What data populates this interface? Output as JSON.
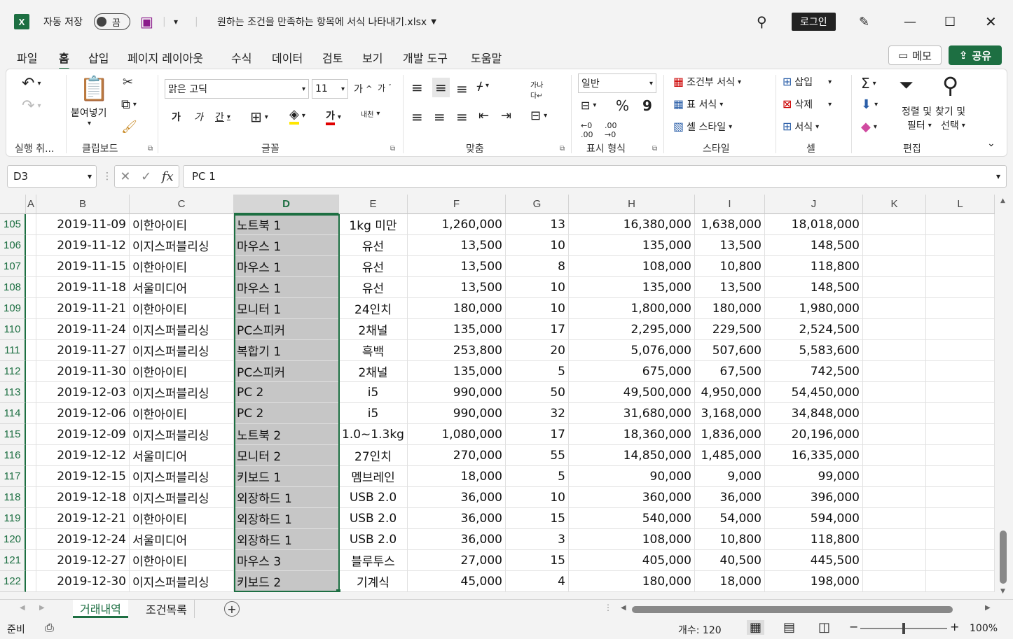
{
  "titlebar": {
    "app_icon": "X",
    "autosave_label": "자동 저장",
    "autosave_state": "끔",
    "filename": "원하는 조건을 만족하는 항목에 서식 나타내기.xlsx",
    "login": "로그인"
  },
  "ribbon_tabs": [
    "파일",
    "홈",
    "삽입",
    "페이지 레이아웃",
    "수식",
    "데이터",
    "검토",
    "보기",
    "개발 도구",
    "도움말"
  ],
  "active_tab": "홈",
  "memo_label": "메모",
  "share_label": "공유",
  "ribbon": {
    "undo_group": "실행 취...",
    "clipboard_group": "클립보드",
    "paste_label": "붙여넣기",
    "font_group": "글꼴",
    "font_name": "맑은 고딕",
    "font_size": "11",
    "grow_font": "가",
    "shrink_font": "가",
    "bold": "가",
    "italic": "가",
    "underline": "간",
    "font_color_letter": "가",
    "phonetic": "내천",
    "align_group": "맞춤",
    "number_group": "표시 형식",
    "number_format": "일반",
    "percent": "%",
    "comma": "9",
    "styles_group": "스타일",
    "conditional": "조건부 서식",
    "format_table": "표 서식",
    "cell_styles": "셀 스타일",
    "cells_group": "셀",
    "insert": "삽입",
    "delete": "삭제",
    "format": "서식",
    "edit_group": "편집",
    "sort_filter_1": "정렬 및",
    "sort_filter_2": "필터",
    "find_select_1": "찾기 및",
    "find_select_2": "선택"
  },
  "formula_bar": {
    "name_box": "D3",
    "fx": "fx",
    "content": "PC 1"
  },
  "columns": [
    "A",
    "B",
    "C",
    "D",
    "E",
    "F",
    "G",
    "H",
    "I",
    "J",
    "K",
    "L"
  ],
  "selected_column": "D",
  "rows": [
    {
      "n": "105",
      "B": "2019-11-09",
      "C": "이한아이티",
      "D": "노트북 1",
      "E": "1kg 미만",
      "F": "1,260,000",
      "G": "13",
      "H": "16,380,000",
      "I": "1,638,000",
      "J": "18,018,000"
    },
    {
      "n": "106",
      "B": "2019-11-12",
      "C": "이지스퍼블리싱",
      "D": "마우스 1",
      "E": "유선",
      "F": "13,500",
      "G": "10",
      "H": "135,000",
      "I": "13,500",
      "J": "148,500"
    },
    {
      "n": "107",
      "B": "2019-11-15",
      "C": "이한아이티",
      "D": "마우스 1",
      "E": "유선",
      "F": "13,500",
      "G": "8",
      "H": "108,000",
      "I": "10,800",
      "J": "118,800"
    },
    {
      "n": "108",
      "B": "2019-11-18",
      "C": "서울미디어",
      "D": "마우스 1",
      "E": "유선",
      "F": "13,500",
      "G": "10",
      "H": "135,000",
      "I": "13,500",
      "J": "148,500"
    },
    {
      "n": "109",
      "B": "2019-11-21",
      "C": "이한아이티",
      "D": "모니터 1",
      "E": "24인치",
      "F": "180,000",
      "G": "10",
      "H": "1,800,000",
      "I": "180,000",
      "J": "1,980,000"
    },
    {
      "n": "110",
      "B": "2019-11-24",
      "C": "이지스퍼블리싱",
      "D": "PC스피커",
      "E": "2채널",
      "F": "135,000",
      "G": "17",
      "H": "2,295,000",
      "I": "229,500",
      "J": "2,524,500"
    },
    {
      "n": "111",
      "B": "2019-11-27",
      "C": "이지스퍼블리싱",
      "D": "복합기 1",
      "E": "흑백",
      "F": "253,800",
      "G": "20",
      "H": "5,076,000",
      "I": "507,600",
      "J": "5,583,600"
    },
    {
      "n": "112",
      "B": "2019-11-30",
      "C": "이한아이티",
      "D": "PC스피커",
      "E": "2채널",
      "F": "135,000",
      "G": "5",
      "H": "675,000",
      "I": "67,500",
      "J": "742,500"
    },
    {
      "n": "113",
      "B": "2019-12-03",
      "C": "이지스퍼블리싱",
      "D": "PC 2",
      "E": "i5",
      "F": "990,000",
      "G": "50",
      "H": "49,500,000",
      "I": "4,950,000",
      "J": "54,450,000"
    },
    {
      "n": "114",
      "B": "2019-12-06",
      "C": "이한아이티",
      "D": "PC 2",
      "E": "i5",
      "F": "990,000",
      "G": "32",
      "H": "31,680,000",
      "I": "3,168,000",
      "J": "34,848,000"
    },
    {
      "n": "115",
      "B": "2019-12-09",
      "C": "이지스퍼블리싱",
      "D": "노트북 2",
      "E": "1.0~1.3kg",
      "F": "1,080,000",
      "G": "17",
      "H": "18,360,000",
      "I": "1,836,000",
      "J": "20,196,000"
    },
    {
      "n": "116",
      "B": "2019-12-12",
      "C": "서울미디어",
      "D": "모니터 2",
      "E": "27인치",
      "F": "270,000",
      "G": "55",
      "H": "14,850,000",
      "I": "1,485,000",
      "J": "16,335,000"
    },
    {
      "n": "117",
      "B": "2019-12-15",
      "C": "이지스퍼블리싱",
      "D": "키보드 1",
      "E": "멤브레인",
      "F": "18,000",
      "G": "5",
      "H": "90,000",
      "I": "9,000",
      "J": "99,000"
    },
    {
      "n": "118",
      "B": "2019-12-18",
      "C": "이지스퍼블리싱",
      "D": "외장하드 1",
      "E": "USB 2.0",
      "F": "36,000",
      "G": "10",
      "H": "360,000",
      "I": "36,000",
      "J": "396,000"
    },
    {
      "n": "119",
      "B": "2019-12-21",
      "C": "이한아이티",
      "D": "외장하드 1",
      "E": "USB 2.0",
      "F": "36,000",
      "G": "15",
      "H": "540,000",
      "I": "54,000",
      "J": "594,000"
    },
    {
      "n": "120",
      "B": "2019-12-24",
      "C": "서울미디어",
      "D": "외장하드 1",
      "E": "USB 2.0",
      "F": "36,000",
      "G": "3",
      "H": "108,000",
      "I": "10,800",
      "J": "118,800"
    },
    {
      "n": "121",
      "B": "2019-12-27",
      "C": "이한아이티",
      "D": "마우스 3",
      "E": "블루투스",
      "F": "27,000",
      "G": "15",
      "H": "405,000",
      "I": "40,500",
      "J": "445,500"
    },
    {
      "n": "122",
      "B": "2019-12-30",
      "C": "이지스퍼블리싱",
      "D": "키보드 2",
      "E": "기계식",
      "F": "45,000",
      "G": "4",
      "H": "180,000",
      "I": "18,000",
      "J": "198,000"
    }
  ],
  "sheets": [
    "거래내역",
    "조건목록"
  ],
  "active_sheet": "거래내역",
  "status": {
    "ready": "준비",
    "count": "개수: 120",
    "zoom": "100%"
  },
  "accent_color": "#1d6f42"
}
